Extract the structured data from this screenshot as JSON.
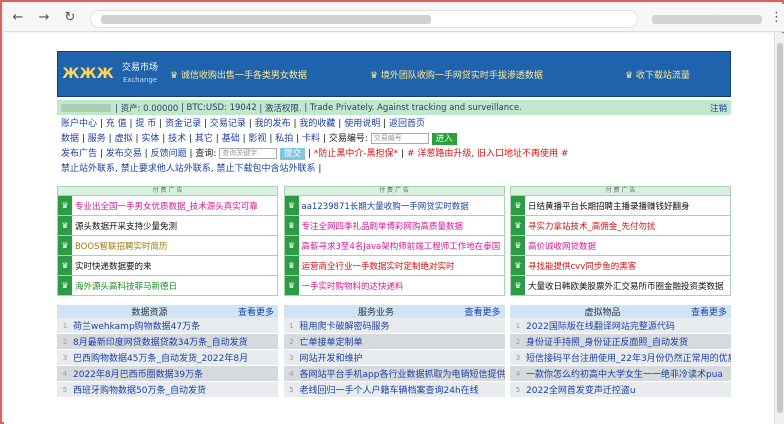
{
  "browser": {
    "back": "←",
    "forward": "→",
    "reload": "↻",
    "star": "☆",
    "menu": "⋮"
  },
  "header": {
    "logo": [
      "ЖЖЖ"
    ],
    "site_name": "交易市场",
    "site_sub": "Exchange",
    "headline1": "♛ 诚信收购出售一手各类男女数据",
    "headline2": "♛ 境外团队收购一手网贷实时手拔渗透数据",
    "headline3": "♛ 收下载站流量"
  },
  "userbar": {
    "assets": "| 资产: 0.00000",
    "btc": "| BTC:USD: 19042",
    "activate": "| 激活权限.",
    "slogan": "| Trade Privately. Against tracking and surveillance.",
    "logout": "注销"
  },
  "nav1": [
    "账户中心",
    "充 值",
    "提 币",
    "资金记录",
    "交易记录",
    "我的发布",
    "我的收藏",
    "使用说明",
    "返回首页"
  ],
  "nav2": [
    "数据",
    "服务",
    "虚拟",
    "实体",
    "技术",
    "其它",
    "基础",
    "影视",
    "私拍",
    "卡料"
  ],
  "trade_label": "交易编号:",
  "trade_placeholder": "交易编号",
  "enter": "进入",
  "nav3": [
    "发布广告",
    "发布交易",
    "反馈问题"
  ],
  "query_label": "查询:",
  "query_placeholder": "查询关键字",
  "submit": "提交",
  "warn1": "*防止黑中介-黑担保*",
  "warn2": "# 洋葱路由升级, 旧入口地址不再使用 #",
  "notice": "禁止站外联系, 禁止要求他人站外联系, 禁止下载包中含站外联系",
  "ad_title": "付 费 广 告",
  "ads": [
    [
      {
        "text": "专业出全国一手男女优质数据_技术源头真实可靠",
        "color": "#d4179a"
      },
      {
        "text": "源头数据开采支持少量免测",
        "color": "#111"
      },
      {
        "text": "BOOS智联招聘实时简历",
        "color": "#9a7a10"
      },
      {
        "text": "实时快递数据要的来",
        "color": "#111"
      },
      {
        "text": "海外源头高科技菲马新德日",
        "color": "#1f8a20"
      }
    ],
    [
      {
        "text": "aa1239871长期大量收购一手网贷实时数据",
        "color": "#1b3fa6"
      },
      {
        "text": "专注全网四季礼品刷单博彩网购高质量数据",
        "color": "#d4179a"
      },
      {
        "text": "高薪寻求3至4名Java架构师前端工程师工作地在泰国",
        "color": "#d4179a"
      },
      {
        "text": "运营商全行业一手数据实时定制绝对实时",
        "color": "#d41010"
      },
      {
        "text": "一手实时购物料的达快递料",
        "color": "#d4179a"
      }
    ],
    [
      {
        "text": "日结黄播平台长期招聘主播录播赚钱好翻身",
        "color": "#111"
      },
      {
        "text": "寻实力拿站技术_高佣金_先付勿扰",
        "color": "#d41010"
      },
      {
        "text": "高价诚收网贷数据",
        "color": "#d4179a"
      },
      {
        "text": "寻找能提供cvv同步鱼的黑客",
        "color": "#d41010"
      },
      {
        "text": "大量收日韩欧美股票外汇交易所币圈金融投资类数据",
        "color": "#111"
      }
    ]
  ],
  "categories": [
    {
      "title": "数据资源",
      "more": "查看更多",
      "rows": [
        "荷兰wehkamp购物数据47万条",
        "8月最新印度网贷数据贷款34万条_自动发货",
        "巴西购物数据45万条_自动发货_2022年8月",
        "2022年8月巴西币圈数据39万条",
        "西班牙购物数据50万条_自动发货"
      ]
    },
    {
      "title": "服务业务",
      "more": "查看更多",
      "rows": [
        "租用爬卡破解密码服务",
        "亡单接单定制单",
        "网站开发和维护",
        "各网站平台手机app各行业数据抓取为电销短信提供",
        "老线回归一手个人户籍车辆档案查询24h在线"
      ]
    },
    {
      "title": "虚拟物品",
      "more": "查看更多",
      "rows": [
        "2022国际版在线翻译网站完整源代码",
        "身份证手持照_身份证正反面照_自动发货",
        "短信接码平台注册使用_22年3月份仍然正常用的优质",
        "一款你怎么约初高中大学女生一一绝非冷读术pua",
        "2022全网首发变声迁控盗u"
      ]
    }
  ]
}
